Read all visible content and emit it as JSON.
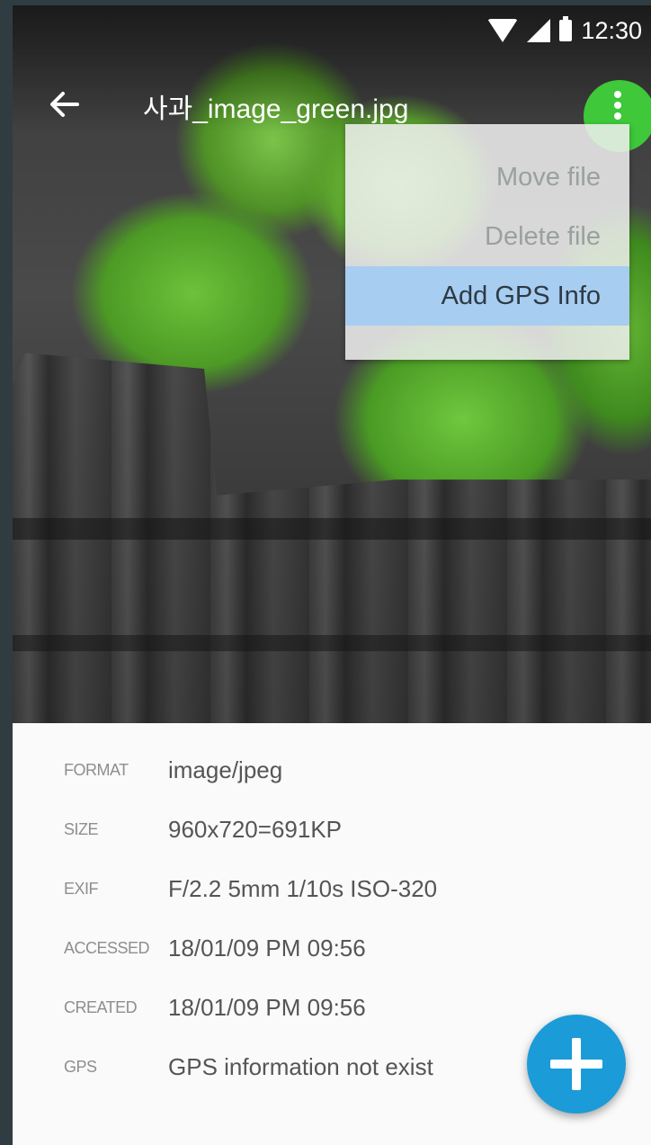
{
  "status_bar": {
    "time": "12:30"
  },
  "app_bar": {
    "title": "사과_image_green.jpg"
  },
  "menu": {
    "items": [
      {
        "label": "Move file"
      },
      {
        "label": "Delete file"
      },
      {
        "label": "Add GPS Info",
        "selected": true
      }
    ]
  },
  "details": {
    "rows": [
      {
        "label": "FORMAT",
        "value": "image/jpeg"
      },
      {
        "label": "SIZE",
        "value": "960x720=691KP"
      },
      {
        "label": "EXIF",
        "value": "F/2.2 5mm 1/10s ISO-320"
      },
      {
        "label": "ACCESSED",
        "value": "18/01/09 PM 09:56"
      },
      {
        "label": "CREATED",
        "value": "18/01/09 PM 09:56"
      },
      {
        "label": "GPS",
        "value": "GPS information not exist"
      }
    ]
  },
  "colors": {
    "fab": "#1b9bd8",
    "overflow_button": "#3ec83a",
    "menu_selected": "#a7cdf0"
  },
  "icons": {
    "back": "arrow-left-icon",
    "overflow": "more-vert-icon",
    "fab": "plus-icon"
  }
}
